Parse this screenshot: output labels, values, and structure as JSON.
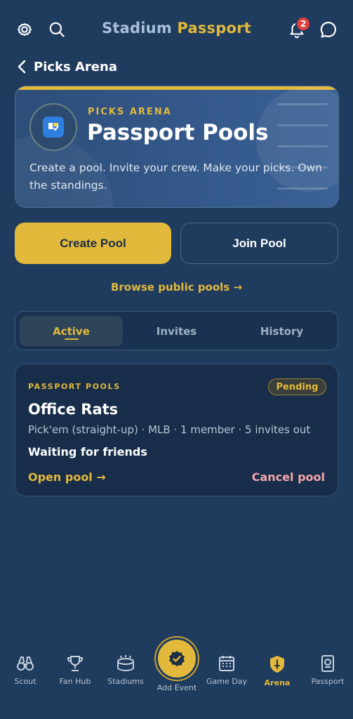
{
  "header": {
    "title_part1": "Stadium",
    "title_part2": "Passport",
    "notification_count": "2"
  },
  "nav": {
    "back_label": "Picks Arena"
  },
  "hero": {
    "kicker": "PICKS ARENA",
    "title": "Passport Pools",
    "description": "Create a pool. Invite your crew. Make your picks. Own the standings."
  },
  "actions": {
    "create_label": "Create Pool",
    "join_label": "Join Pool",
    "browse_label": "Browse public pools →"
  },
  "tabs": [
    {
      "label": "Active",
      "active": true
    },
    {
      "label": "Invites",
      "active": false
    },
    {
      "label": "History",
      "active": false
    }
  ],
  "pool": {
    "kicker": "PASSPORT POOLS",
    "badge": "Pending",
    "name": "Office Rats",
    "meta": "Pick'em (straight-up) · MLB · 1 member · 5 invites out",
    "status": "Waiting for friends",
    "open_label": "Open pool →",
    "cancel_label": "Cancel pool"
  },
  "bottom_nav": [
    {
      "label": "Scout",
      "icon": "binoculars-icon"
    },
    {
      "label": "Fan Hub",
      "icon": "trophy-icon"
    },
    {
      "label": "Stadiums",
      "icon": "stadium-icon"
    },
    {
      "label": "Add Event",
      "icon": "check-icon"
    },
    {
      "label": "Game Day",
      "icon": "calendar-icon"
    },
    {
      "label": "Arena",
      "icon": "shield-icon",
      "active": true
    },
    {
      "label": "Passport",
      "icon": "passport-icon"
    }
  ],
  "colors": {
    "background": "#1f3b5e",
    "accent": "#e2b93b",
    "danger": "#f2a7ad",
    "badge": "#e0413f"
  }
}
